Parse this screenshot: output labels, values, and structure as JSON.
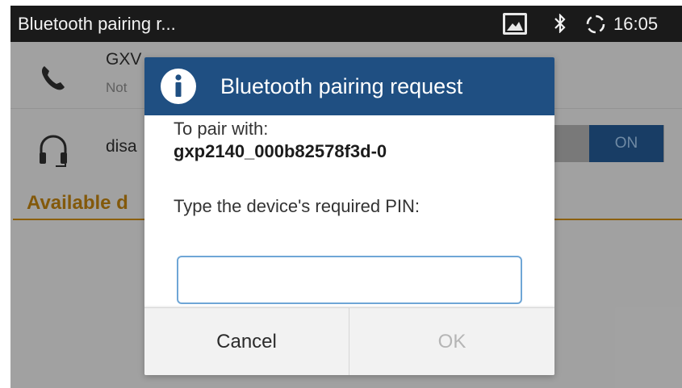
{
  "status_bar": {
    "title": "Bluetooth pairing r...",
    "time": "16:05",
    "icons": [
      "image-icon",
      "bluetooth-icon",
      "sync-icon"
    ]
  },
  "background": {
    "device_name": "GXV",
    "device_status": "Not",
    "headset_label": "disa",
    "toggle_label": "ON",
    "section_title": "Available d",
    "icons": [
      "phone-icon",
      "headset-icon"
    ]
  },
  "dialog": {
    "title": "Bluetooth pairing request",
    "pair_label": "To pair with:",
    "device_id": "gxp2140_000b82578f3d-0",
    "pin_prompt": "Type the device's required PIN:",
    "pin_value": "",
    "cancel_label": "Cancel",
    "ok_label": "OK",
    "icon": "info-icon"
  },
  "colors": {
    "header_blue": "#1f4f82",
    "accent_orange": "#b37a10",
    "input_border": "#6fa6d6"
  }
}
